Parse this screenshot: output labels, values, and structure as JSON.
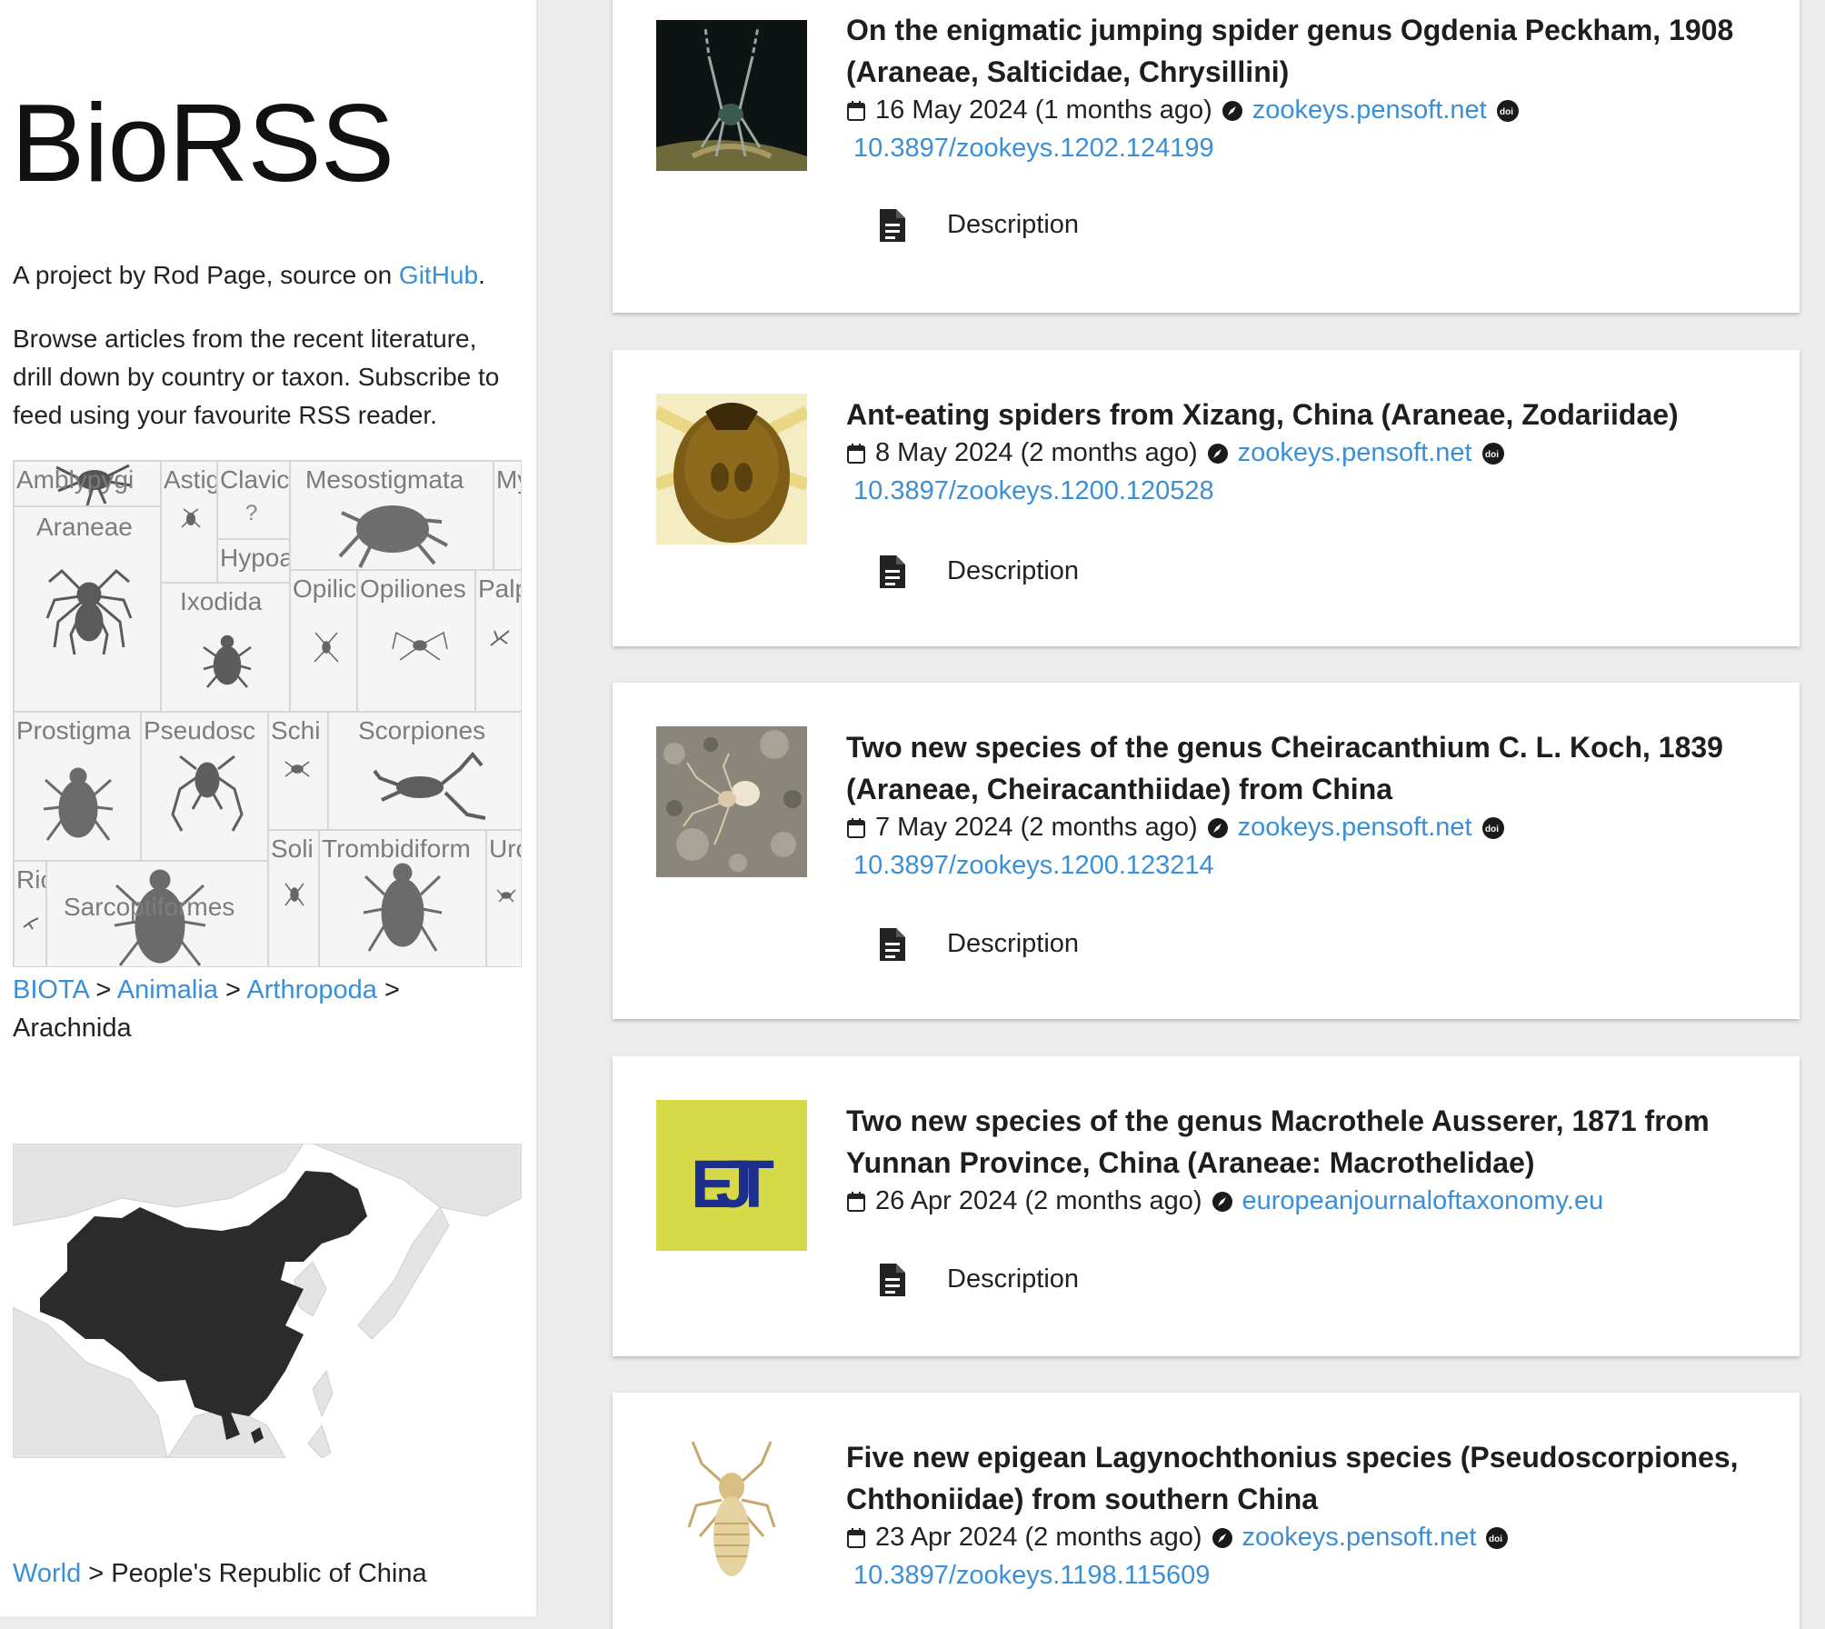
{
  "site": {
    "title": "BioRSS",
    "intro_prefix": "A project by Rod Page, source on ",
    "github_link": "GitHub",
    "intro_suffix": ".",
    "blurb": "Browse articles from the recent literature, drill down by country or taxon. Subscribe to feed using your favourite RSS reader."
  },
  "treemap": {
    "cells": [
      "Amblypygi",
      "Astig",
      "Clavic",
      "Mesostigmata",
      "My",
      "Araneae",
      "Hypoa",
      "Ixodida",
      "Opilic",
      "Opiliones",
      "Palp",
      "Prostigma",
      "Pseudosc",
      "Schi",
      "Scorpiones",
      "Soli",
      "Trombidiform",
      "Uro",
      "Ric",
      "Sarcoptiformes"
    ]
  },
  "taxon_breadcrumb": {
    "links": [
      "BIOTA",
      "Animalia",
      "Arthropoda"
    ],
    "separator": ">",
    "current": "Arachnida"
  },
  "place_breadcrumb": {
    "link": "World",
    "separator": ">",
    "current": "People's Republic of China"
  },
  "articles": [
    {
      "title": "On the enigmatic jumping spider genus Ogdenia Peckham, 1908 (Araneae, Salticidae, Chrysillini)",
      "date": "16 May 2024 (1 months ago)",
      "source": "zookeys.pensoft.net",
      "doi": "10.3897/zookeys.1202.124199",
      "description_label": "Description"
    },
    {
      "title": "Ant-eating spiders from Xizang, China (Araneae, Zodariidae)",
      "date": "8 May 2024 (2 months ago)",
      "source": "zookeys.pensoft.net",
      "doi": "10.3897/zookeys.1200.120528",
      "description_label": "Description"
    },
    {
      "title": "Two new species of the genus Cheiracanthium C. L. Koch, 1839 (Araneae, Cheiracanthiidae) from China",
      "date": "7 May 2024 (2 months ago)",
      "source": "zookeys.pensoft.net",
      "doi": "10.3897/zookeys.1200.123214",
      "description_label": "Description"
    },
    {
      "title": "Two new species of the genus Macrothele Ausserer, 1871 from Yunnan Province, China (Araneae: Macrothelidae)",
      "date": "26 Apr 2024 (2 months ago)",
      "source": "europeanjournaloftaxonomy.eu",
      "thumb_text": "EJT",
      "description_label": "Description"
    },
    {
      "title": "Five new epigean Lagynochthonius species (Pseudoscorpiones, Chthoniidae) from southern China",
      "date": "23 Apr 2024 (2 months ago)",
      "source": "zookeys.pensoft.net",
      "doi": "10.3897/zookeys.1198.115609"
    }
  ],
  "colors": {
    "link": "#3b8fd6",
    "page_background": "#ececec",
    "map_highlight": "#2b2b2b",
    "map_land": "#dadada",
    "ejt_yellow": "#d6da49",
    "ejt_blue": "#1c2f8c"
  },
  "icons": {
    "calendar": "calendar-icon",
    "source": "compass-icon",
    "doi": "doi-icon",
    "description": "document-icon"
  }
}
